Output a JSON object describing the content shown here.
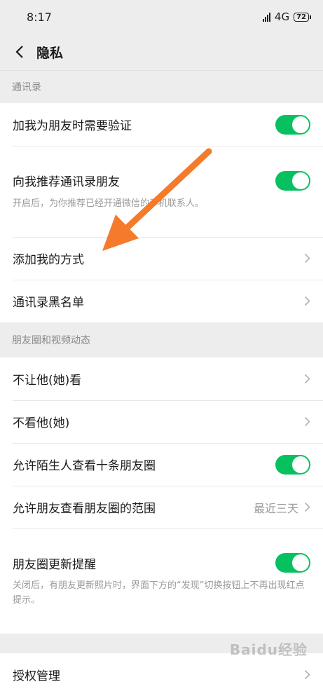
{
  "status": {
    "time": "8:17",
    "network": "4G",
    "battery": "72"
  },
  "header": {
    "title": "隐私"
  },
  "sections": {
    "contacts": {
      "title": "通讯录",
      "verify_label": "加我为朋友时需要验证",
      "recommend_label": "向我推荐通讯录朋友",
      "recommend_desc": "开启后，为你推荐已经开通微信的手机联系人。",
      "add_method_label": "添加我的方式",
      "blacklist_label": "通讯录黑名单"
    },
    "moments": {
      "title": "朋友圈和视频动态",
      "hide_from_label": "不让他(她)看",
      "dont_see_label": "不看他(她)",
      "stranger_label": "允许陌生人查看十条朋友圈",
      "range_label": "允许朋友查看朋友圈的范围",
      "range_value": "最近三天",
      "update_label": "朋友圈更新提醒",
      "update_desc": "关闭后，有朋友更新照片时，界面下方的“发现”切换按钮上不再出现红点提示。"
    },
    "auth": {
      "label": "授权管理"
    }
  },
  "watermark": "Baidu经验",
  "colors": {
    "toggle_on": "#07c160",
    "arrow": "#f47a2c",
    "background": "#ededed"
  }
}
